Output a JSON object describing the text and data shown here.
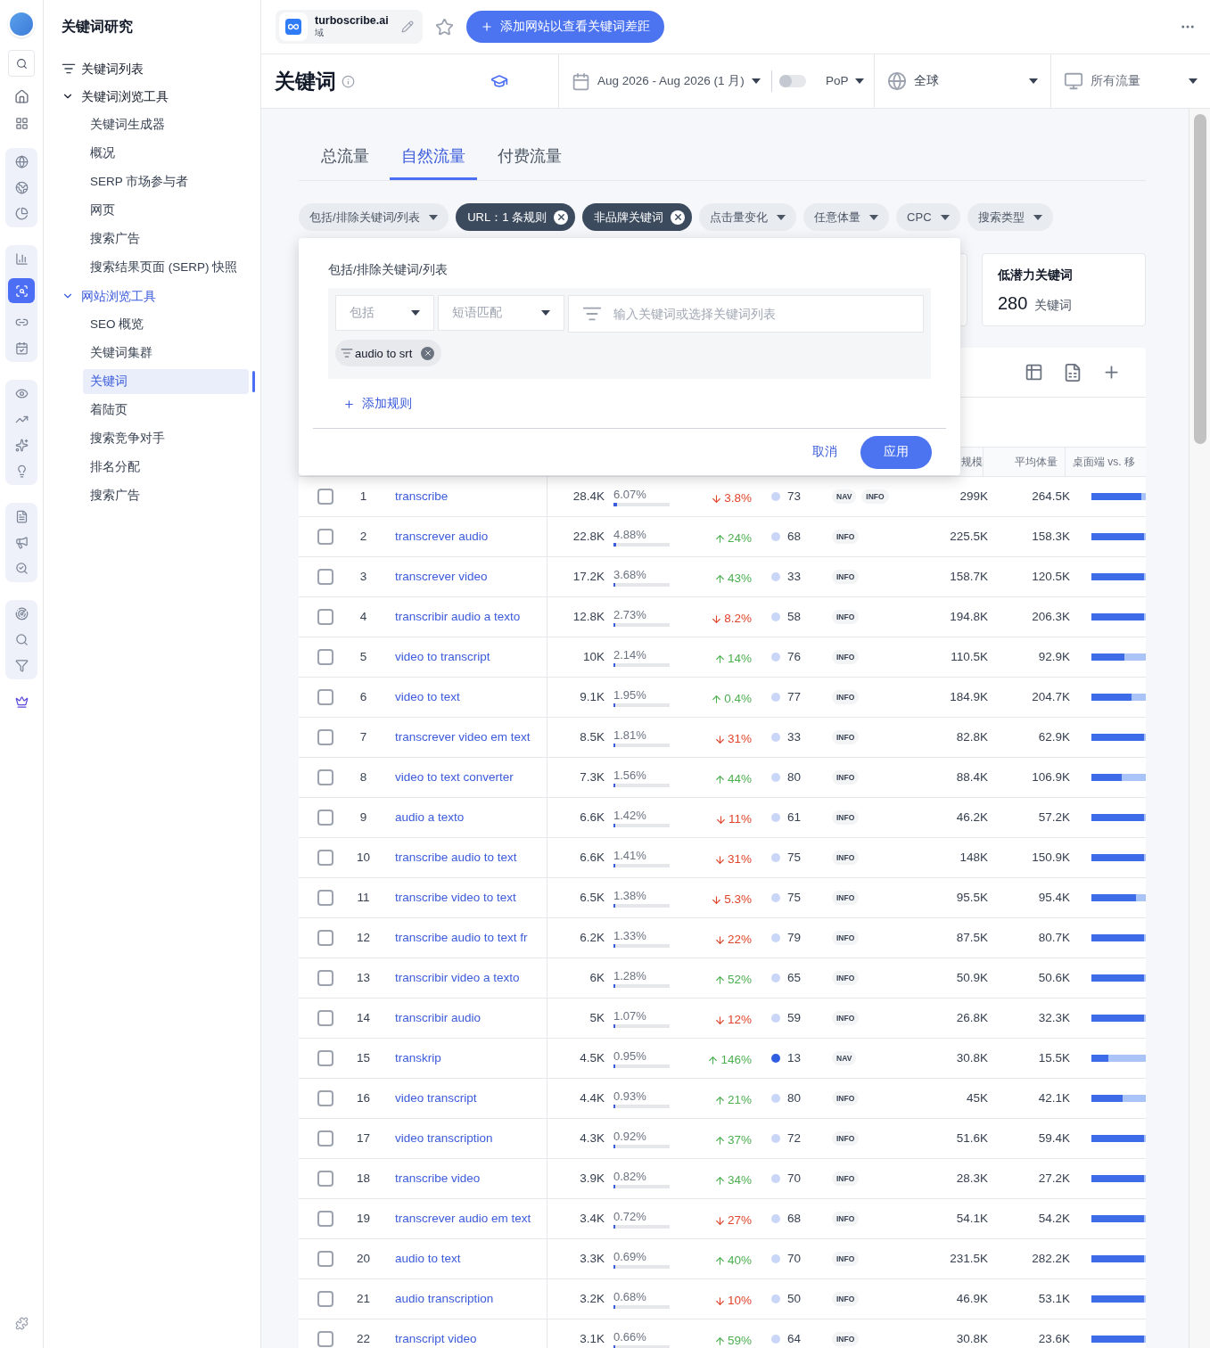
{
  "sidebar": {
    "title": "关键词研究",
    "items": [
      {
        "kind": "link",
        "label": "关键词列表"
      },
      {
        "kind": "group",
        "label": "关键词浏览工具",
        "expanded": true,
        "active": false,
        "children": [
          {
            "label": "关键词生成器",
            "selected": false
          },
          {
            "label": "概况",
            "selected": false
          },
          {
            "label": "SERP 市场参与者",
            "selected": false
          },
          {
            "label": "网页",
            "selected": false
          },
          {
            "label": "搜索广告",
            "selected": false
          },
          {
            "label": "搜索结果页面 (SERP) 快照",
            "selected": false
          }
        ]
      },
      {
        "kind": "group",
        "label": "网站浏览工具",
        "expanded": true,
        "active": true,
        "children": [
          {
            "label": "SEO 概览",
            "selected": false
          },
          {
            "label": "关键词集群",
            "selected": false
          },
          {
            "label": "关键词",
            "selected": true
          },
          {
            "label": "着陆页",
            "selected": false
          },
          {
            "label": "搜索竞争对手",
            "selected": false
          },
          {
            "label": "排名分配",
            "selected": false
          },
          {
            "label": "搜索广告",
            "selected": false
          }
        ]
      }
    ]
  },
  "header": {
    "domain": "turboscribe.ai",
    "domain_sub": "域",
    "add_button": "添加网站以查看关键词差距"
  },
  "toolbar": {
    "title": "关键词",
    "date_range": "Aug 2026 - Aug 2026 (1 月)",
    "compare_on": false,
    "compare_label": "PoP",
    "region": "全球",
    "traffic": "所有流量"
  },
  "traffic_tabs": [
    {
      "label": "总流量",
      "selected": false
    },
    {
      "label": "自然流量",
      "selected": true
    },
    {
      "label": "付费流量",
      "selected": false
    }
  ],
  "filters": [
    {
      "kind": "dropdown",
      "label": "包括/排除关键词/列表"
    },
    {
      "kind": "applied",
      "label": "URL：1 条规则"
    },
    {
      "kind": "applied",
      "label": "非品牌关键词"
    },
    {
      "kind": "dropdown",
      "label": "点击量变化"
    },
    {
      "kind": "dropdown",
      "label": "任意体量"
    },
    {
      "kind": "dropdown",
      "label": "CPC"
    },
    {
      "kind": "dropdown",
      "label": "搜索类型"
    }
  ],
  "popup": {
    "title": "包括/排除关键词/列表",
    "mode": "包括",
    "match": "短语匹配",
    "placeholder": "输入关键词或选择关键词列表",
    "chips": [
      "audio to srt"
    ],
    "add_rule": "添加规则",
    "cancel": "取消",
    "apply": "应用"
  },
  "summary_card": {
    "title": "低潜力关键词",
    "value": "280",
    "unit": "关键词"
  },
  "table": {
    "columns": [
      "规模",
      "平均体量",
      "桌面端 vs. 移"
    ],
    "rows": [
      {
        "checked": false,
        "index": "1",
        "keyword": "transcribe",
        "clicks": "28.4K",
        "share": {
          "text": "6.07%",
          "level": 0.0607
        },
        "change": {
          "kind": "down",
          "text": "3.8%"
        },
        "kd": {
          "value": "73",
          "color": "#c9d6f7"
        },
        "intents": [
          "NAV",
          "INFO"
        ],
        "volume": "299K",
        "avg_volume": "264.5K",
        "device": {
          "level": 0.95
        }
      },
      {
        "checked": false,
        "index": "2",
        "keyword": "transcrever audio",
        "clicks": "22.8K",
        "share": {
          "text": "4.88%",
          "level": 0.0488
        },
        "change": {
          "kind": "up",
          "text": "24%"
        },
        "kd": {
          "value": "68",
          "color": "#c9d6f7"
        },
        "intents": [
          "INFO"
        ],
        "volume": "225.5K",
        "avg_volume": "158.3K",
        "device": {
          "level": 1
        }
      },
      {
        "checked": false,
        "index": "3",
        "keyword": "transcrever video",
        "clicks": "17.2K",
        "share": {
          "text": "3.68%",
          "level": 0.0368
        },
        "change": {
          "kind": "up",
          "text": "43%"
        },
        "kd": {
          "value": "33",
          "color": "#c9d6f7"
        },
        "intents": [
          "INFO"
        ],
        "volume": "158.7K",
        "avg_volume": "120.5K",
        "device": {
          "level": 1
        }
      },
      {
        "checked": false,
        "index": "4",
        "keyword": "transcribir audio a texto",
        "clicks": "12.8K",
        "share": {
          "text": "2.73%",
          "level": 0.0273
        },
        "change": {
          "kind": "down",
          "text": "8.2%"
        },
        "kd": {
          "value": "58",
          "color": "#c9d6f7"
        },
        "intents": [
          "INFO"
        ],
        "volume": "194.8K",
        "avg_volume": "206.3K",
        "device": {
          "level": 1
        }
      },
      {
        "checked": false,
        "index": "5",
        "keyword": "video to transcript",
        "clicks": "10K",
        "share": {
          "text": "2.14%",
          "level": 0.0214
        },
        "change": {
          "kind": "up",
          "text": "14%"
        },
        "kd": {
          "value": "76",
          "color": "#c9d6f7"
        },
        "intents": [
          "INFO"
        ],
        "volume": "110.5K",
        "avg_volume": "92.9K",
        "device": {
          "level": 0.62
        }
      },
      {
        "checked": false,
        "index": "6",
        "keyword": "video to text",
        "clicks": "9.1K",
        "share": {
          "text": "1.95%",
          "level": 0.0195
        },
        "change": {
          "kind": "up",
          "text": "0.4%"
        },
        "kd": {
          "value": "77",
          "color": "#c9d6f7"
        },
        "intents": [
          "INFO"
        ],
        "volume": "184.9K",
        "avg_volume": "204.7K",
        "device": {
          "level": 0.77
        }
      },
      {
        "checked": false,
        "index": "7",
        "keyword": "transcrever video em text",
        "clicks": "8.5K",
        "share": {
          "text": "1.81%",
          "level": 0.0181
        },
        "change": {
          "kind": "down",
          "text": "31%"
        },
        "kd": {
          "value": "33",
          "color": "#c9d6f7"
        },
        "intents": [
          "INFO"
        ],
        "volume": "82.8K",
        "avg_volume": "62.9K",
        "device": {
          "level": 1
        }
      },
      {
        "checked": false,
        "index": "8",
        "keyword": "video to text converter",
        "clicks": "7.3K",
        "share": {
          "text": "1.56%",
          "level": 0.0156
        },
        "change": {
          "kind": "up",
          "text": "44%"
        },
        "kd": {
          "value": "80",
          "color": "#c9d6f7"
        },
        "intents": [
          "INFO"
        ],
        "volume": "88.4K",
        "avg_volume": "106.9K",
        "device": {
          "level": 0.57
        }
      },
      {
        "checked": false,
        "index": "9",
        "keyword": "audio a texto",
        "clicks": "6.6K",
        "share": {
          "text": "1.42%",
          "level": 0.0142
        },
        "change": {
          "kind": "down",
          "text": "11%"
        },
        "kd": {
          "value": "61",
          "color": "#c9d6f7"
        },
        "intents": [
          "INFO"
        ],
        "volume": "46.2K",
        "avg_volume": "57.2K",
        "device": {
          "level": 1
        }
      },
      {
        "checked": false,
        "index": "10",
        "keyword": "transcribe audio to text",
        "clicks": "6.6K",
        "share": {
          "text": "1.41%",
          "level": 0.0141
        },
        "change": {
          "kind": "down",
          "text": "31%"
        },
        "kd": {
          "value": "75",
          "color": "#c9d6f7"
        },
        "intents": [
          "INFO"
        ],
        "volume": "148K",
        "avg_volume": "150.9K",
        "device": {
          "level": 1
        }
      },
      {
        "checked": false,
        "index": "11",
        "keyword": "transcribe video to text",
        "clicks": "6.5K",
        "share": {
          "text": "1.38%",
          "level": 0.0138
        },
        "change": {
          "kind": "down",
          "text": "5.3%"
        },
        "kd": {
          "value": "75",
          "color": "#c9d6f7"
        },
        "intents": [
          "INFO"
        ],
        "volume": "95.5K",
        "avg_volume": "95.4K",
        "device": {
          "level": 0.84
        }
      },
      {
        "checked": false,
        "index": "12",
        "keyword": "transcribe audio to text fr",
        "clicks": "6.2K",
        "share": {
          "text": "1.33%",
          "level": 0.0133
        },
        "change": {
          "kind": "down",
          "text": "22%"
        },
        "kd": {
          "value": "79",
          "color": "#c9d6f7"
        },
        "intents": [
          "INFO"
        ],
        "volume": "87.5K",
        "avg_volume": "80.7K",
        "device": {
          "level": 1
        }
      },
      {
        "checked": false,
        "index": "13",
        "keyword": "transcribir video a texto",
        "clicks": "6K",
        "share": {
          "text": "1.28%",
          "level": 0.0128
        },
        "change": {
          "kind": "up",
          "text": "52%"
        },
        "kd": {
          "value": "65",
          "color": "#c9d6f7"
        },
        "intents": [
          "INFO"
        ],
        "volume": "50.9K",
        "avg_volume": "50.6K",
        "device": {
          "level": 1
        }
      },
      {
        "checked": false,
        "index": "14",
        "keyword": "transcribir audio",
        "clicks": "5K",
        "share": {
          "text": "1.07%",
          "level": 0.0107
        },
        "change": {
          "kind": "down",
          "text": "12%"
        },
        "kd": {
          "value": "59",
          "color": "#c9d6f7"
        },
        "intents": [
          "INFO"
        ],
        "volume": "26.8K",
        "avg_volume": "32.3K",
        "device": {
          "level": 1
        }
      },
      {
        "checked": false,
        "index": "15",
        "keyword": "transkrip",
        "clicks": "4.5K",
        "share": {
          "text": "0.95%",
          "level": 0.0095
        },
        "change": {
          "kind": "up",
          "text": "146%"
        },
        "kd": {
          "value": "13",
          "color": "#2f5fe0"
        },
        "intents": [
          "NAV"
        ],
        "volume": "30.8K",
        "avg_volume": "15.5K",
        "device": {
          "level": 0.32
        }
      },
      {
        "checked": false,
        "index": "16",
        "keyword": "video transcript",
        "clicks": "4.4K",
        "share": {
          "text": "0.93%",
          "level": 0.0093
        },
        "change": {
          "kind": "up",
          "text": "21%"
        },
        "kd": {
          "value": "80",
          "color": "#c9d6f7"
        },
        "intents": [
          "INFO"
        ],
        "volume": "45K",
        "avg_volume": "42.1K",
        "device": {
          "level": 0.6
        }
      },
      {
        "checked": false,
        "index": "17",
        "keyword": "video transcription",
        "clicks": "4.3K",
        "share": {
          "text": "0.92%",
          "level": 0.0092
        },
        "change": {
          "kind": "up",
          "text": "37%"
        },
        "kd": {
          "value": "72",
          "color": "#c9d6f7"
        },
        "intents": [
          "INFO"
        ],
        "volume": "51.6K",
        "avg_volume": "59.4K",
        "device": {
          "level": 1
        }
      },
      {
        "checked": false,
        "index": "18",
        "keyword": "transcribe video",
        "clicks": "3.9K",
        "share": {
          "text": "0.82%",
          "level": 0.0082
        },
        "change": {
          "kind": "up",
          "text": "34%"
        },
        "kd": {
          "value": "70",
          "color": "#c9d6f7"
        },
        "intents": [
          "INFO"
        ],
        "volume": "28.3K",
        "avg_volume": "27.2K",
        "device": {
          "level": 1
        }
      },
      {
        "checked": false,
        "index": "19",
        "keyword": "transcrever audio em text",
        "clicks": "3.4K",
        "share": {
          "text": "0.72%",
          "level": 0.0072
        },
        "change": {
          "kind": "down",
          "text": "27%"
        },
        "kd": {
          "value": "68",
          "color": "#c9d6f7"
        },
        "intents": [
          "INFO"
        ],
        "volume": "54.1K",
        "avg_volume": "54.2K",
        "device": {
          "level": 1
        }
      },
      {
        "checked": false,
        "index": "20",
        "keyword": "audio to text",
        "clicks": "3.3K",
        "share": {
          "text": "0.69%",
          "level": 0.0069
        },
        "change": {
          "kind": "up",
          "text": "40%"
        },
        "kd": {
          "value": "70",
          "color": "#c9d6f7"
        },
        "intents": [
          "INFO"
        ],
        "volume": "231.5K",
        "avg_volume": "282.2K",
        "device": {
          "level": 1
        }
      },
      {
        "checked": false,
        "index": "21",
        "keyword": "audio transcription",
        "clicks": "3.2K",
        "share": {
          "text": "0.68%",
          "level": 0.0068
        },
        "change": {
          "kind": "down",
          "text": "10%"
        },
        "kd": {
          "value": "50",
          "color": "#c9d6f7"
        },
        "intents": [
          "INFO"
        ],
        "volume": "46.9K",
        "avg_volume": "53.1K",
        "device": {
          "level": 1
        }
      },
      {
        "checked": false,
        "index": "22",
        "keyword": "transcript video",
        "clicks": "3.1K",
        "share": {
          "text": "0.66%",
          "level": 0.0066
        },
        "change": {
          "kind": "up",
          "text": "59%"
        },
        "kd": {
          "value": "64",
          "color": "#c9d6f7"
        },
        "intents": [
          "INFO"
        ],
        "volume": "30.8K",
        "avg_volume": "23.6K",
        "device": {
          "level": 1
        }
      }
    ]
  }
}
